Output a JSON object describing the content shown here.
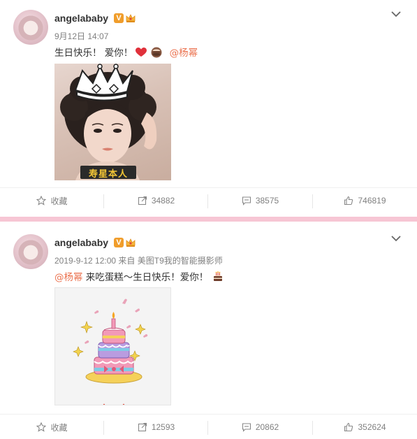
{
  "posts": [
    {
      "username": "angelababy",
      "verified_badge": "V",
      "meta": "9月12日 14:07",
      "text_before": "生日快乐！ 爱你！",
      "mention": "@杨幂",
      "text_after": "",
      "emoji": [
        "heart-icon",
        "cake-emoji-icon"
      ],
      "photo_caption": "寿星本人",
      "actions": {
        "favorite": "收藏",
        "repost": "34882",
        "comment": "38575",
        "like": "746819"
      }
    },
    {
      "username": "angelababy",
      "verified_badge": "V",
      "meta": "2019-9-12 12:00 来自 美图T9我的智能摄影师",
      "text_before": "",
      "mention": "@杨幂",
      "text_after": " 来吃蛋糕～生日快乐！爱你！",
      "emoji": [
        "cake-emoji-icon"
      ],
      "actions": {
        "favorite": "收藏",
        "repost": "12593",
        "comment": "20862",
        "like": "352624"
      }
    }
  ],
  "colors": {
    "mention": "#eb7350",
    "badge": "#f09d2b",
    "divider": "#f7c6d4",
    "meta": "#808080"
  }
}
